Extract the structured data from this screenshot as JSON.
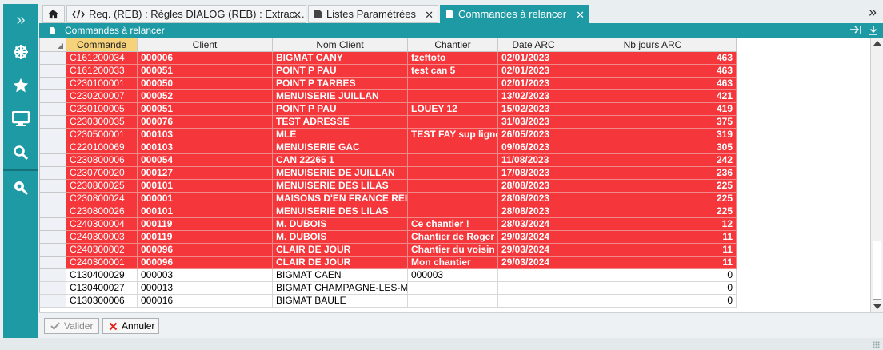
{
  "sidebar": {
    "items": [
      {
        "icon": "expand-chevrons-icon",
        "glyph": "»"
      },
      {
        "icon": "dharma-wheel-icon"
      },
      {
        "icon": "star-icon"
      },
      {
        "icon": "monitor-icon"
      },
      {
        "icon": "search-icon"
      },
      {
        "icon": "location-search-icon"
      }
    ]
  },
  "tabs": [
    {
      "icon": "home-icon",
      "label": ""
    },
    {
      "icon": "code-icon",
      "label": "Req. (REB) : Règles DIALOG (REB) : Extrac…",
      "close": "✕"
    },
    {
      "icon": "document-icon",
      "label": "Listes Paramétrées",
      "close": "✕"
    },
    {
      "icon": "document-icon",
      "label": "Commandes à relancer",
      "close": "✕"
    }
  ],
  "tab_overflow": "»",
  "panel": {
    "title": "Commandes à relancer"
  },
  "columns": [
    "Commande",
    "Client",
    "Nom Client",
    "Chantier",
    "Date ARC",
    "Nb jours ARC"
  ],
  "rows": [
    {
      "highlight": true,
      "cells": [
        "C161200034",
        "000006",
        "BIGMAT CANY",
        "fzeftoto",
        "02/01/2023",
        "463"
      ]
    },
    {
      "highlight": true,
      "cells": [
        "C161200033",
        "000051",
        "POINT P PAU",
        "test can 5",
        "02/01/2023",
        "463"
      ]
    },
    {
      "highlight": true,
      "cells": [
        "C230100001",
        "000050",
        "POINT P TARBES",
        "",
        "02/01/2023",
        "463"
      ]
    },
    {
      "highlight": true,
      "cells": [
        "C230200007",
        "000052",
        "MENUISERIE JUILLAN",
        "",
        "13/02/2023",
        "421"
      ]
    },
    {
      "highlight": true,
      "cells": [
        "C230100005",
        "000051",
        "POINT P PAU",
        "LOUEY 12",
        "15/02/2023",
        "419"
      ]
    },
    {
      "highlight": true,
      "cells": [
        "C230300035",
        "000076",
        "TEST ADRESSE",
        "",
        "31/03/2023",
        "375"
      ]
    },
    {
      "highlight": true,
      "cells": [
        "C230500001",
        "000103",
        "MLE",
        "TEST FAY sup ligne",
        "26/05/2023",
        "319"
      ]
    },
    {
      "highlight": true,
      "cells": [
        "C220100069",
        "000103",
        "MENUISERIE GAC",
        "",
        "09/06/2023",
        "305"
      ]
    },
    {
      "highlight": true,
      "cells": [
        "C230800006",
        "000054",
        "CAN 22265 1",
        "",
        "11/08/2023",
        "242"
      ]
    },
    {
      "highlight": true,
      "cells": [
        "C230700020",
        "000127",
        "MENUISERIE DE JUILLAN",
        "",
        "17/08/2023",
        "236"
      ]
    },
    {
      "highlight": true,
      "cells": [
        "C230800025",
        "000101",
        "MENUISERIE DES LILAS",
        "",
        "28/08/2023",
        "225"
      ]
    },
    {
      "highlight": true,
      "cells": [
        "C230800024",
        "000001",
        "MAISONS D'EN FRANCE REI",
        "",
        "28/08/2023",
        "225"
      ]
    },
    {
      "highlight": true,
      "cells": [
        "C230800026",
        "000101",
        "MENUISERIE DES LILAS",
        "",
        "28/08/2023",
        "225"
      ]
    },
    {
      "highlight": true,
      "cells": [
        "C240300004",
        "000119",
        "M. DUBOIS",
        "Ce chantier !",
        "28/03/2024",
        "12"
      ]
    },
    {
      "highlight": true,
      "cells": [
        "C240300003",
        "000119",
        "M. DUBOIS",
        "Chantier de Roger",
        "29/03/2024",
        "11"
      ]
    },
    {
      "highlight": true,
      "cells": [
        "C240300002",
        "000096",
        "CLAIR DE JOUR",
        "Chantier du voisin",
        "29/03/2024",
        "11"
      ]
    },
    {
      "highlight": true,
      "cells": [
        "C240300001",
        "000096",
        "CLAIR DE JOUR",
        "Mon chantier",
        "29/03/2024",
        "11"
      ]
    },
    {
      "highlight": false,
      "cells": [
        "C130400029",
        "000003",
        "BIGMAT CAEN",
        "000003",
        "",
        "0"
      ]
    },
    {
      "highlight": false,
      "cells": [
        "C130400027",
        "000013",
        "BIGMAT CHAMPAGNE-LES-MARAI",
        "",
        "",
        "0"
      ]
    },
    {
      "highlight": false,
      "cells": [
        "C130300006",
        "000016",
        "BIGMAT BAULE",
        "",
        "",
        "0"
      ]
    }
  ],
  "footer": {
    "validate_label": "Valider",
    "cancel_label": "Annuler"
  },
  "colors": {
    "accent": "#1d9aa4",
    "highlight_row": "#f5363b",
    "sorted_header": "#f6d37a"
  }
}
